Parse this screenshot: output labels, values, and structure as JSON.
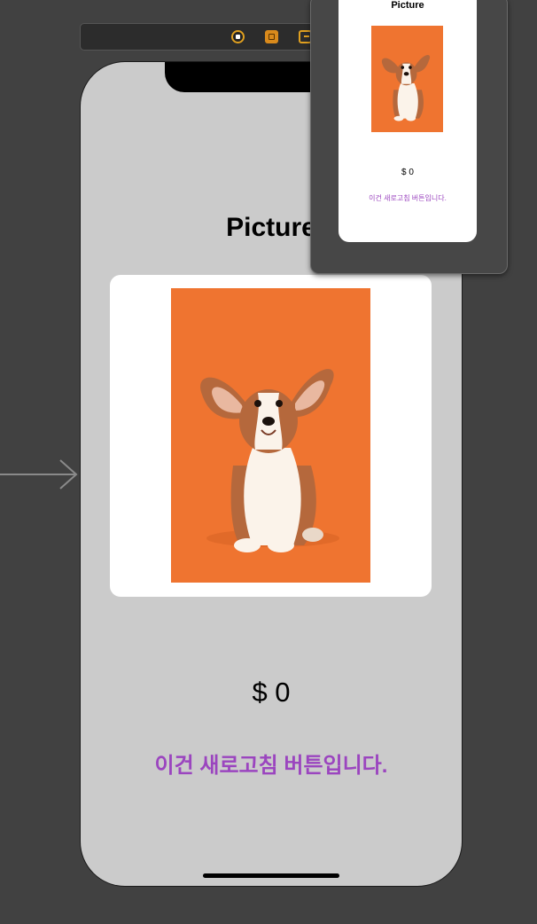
{
  "toolbar": {
    "icons": [
      "view-controller-icon",
      "first-responder-icon",
      "exit-icon"
    ]
  },
  "screen": {
    "title": "Picture",
    "image": "corgi-puppy-photo",
    "price": "$ 0",
    "refresh_button": "이건 새로고침 버튼입니다."
  },
  "preview": {
    "title": "Picture",
    "price": "$ 0",
    "refresh_button": "이건 새로고침 버튼입니다."
  },
  "colors": {
    "canvas": "#414141",
    "phone_bg": "#cbcbcb",
    "accent": "#9b45bf",
    "photo_bg": "#ef7430"
  }
}
